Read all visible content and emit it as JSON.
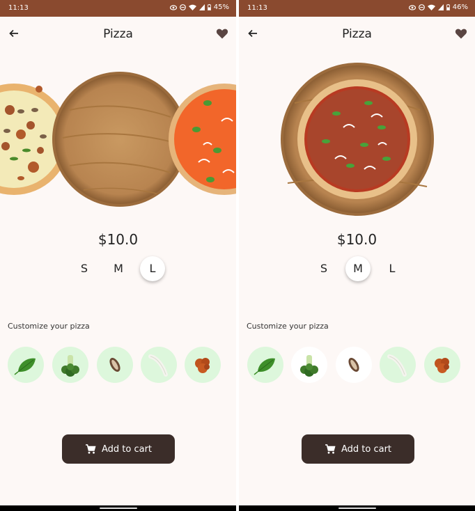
{
  "screens": [
    {
      "status_time": "11:13",
      "battery": "45%",
      "title": "Pizza",
      "price": "$10.0",
      "sizes": [
        "S",
        "M",
        "L"
      ],
      "selected_size": "L",
      "customize_label": "Customize your pizza",
      "toppings": [
        {
          "icon": "basil-icon",
          "active": true
        },
        {
          "icon": "broccoli-icon",
          "active": true
        },
        {
          "icon": "mushroom-icon",
          "active": true
        },
        {
          "icon": "onion-icon",
          "active": true
        },
        {
          "icon": "sausage-icon",
          "active": true
        }
      ],
      "add_to_cart": "Add to cart"
    },
    {
      "status_time": "11:13",
      "battery": "46%",
      "title": "Pizza",
      "price": "$10.0",
      "sizes": [
        "S",
        "M",
        "L"
      ],
      "selected_size": "M",
      "customize_label": "Customize your pizza",
      "toppings": [
        {
          "icon": "basil-icon",
          "active": true
        },
        {
          "icon": "broccoli-icon",
          "active": false
        },
        {
          "icon": "mushroom-icon",
          "active": false
        },
        {
          "icon": "onion-icon",
          "active": true
        },
        {
          "icon": "sausage-icon",
          "active": true
        }
      ],
      "add_to_cart": "Add to cart"
    }
  ],
  "colors": {
    "status_bar": "#8a4a2f",
    "background": "#fdf8f6",
    "button": "#3b2d29",
    "topping_active_bg": "#ddf7dc",
    "topping_inactive_bg": "#ffffff",
    "wood": "#c8955a"
  }
}
